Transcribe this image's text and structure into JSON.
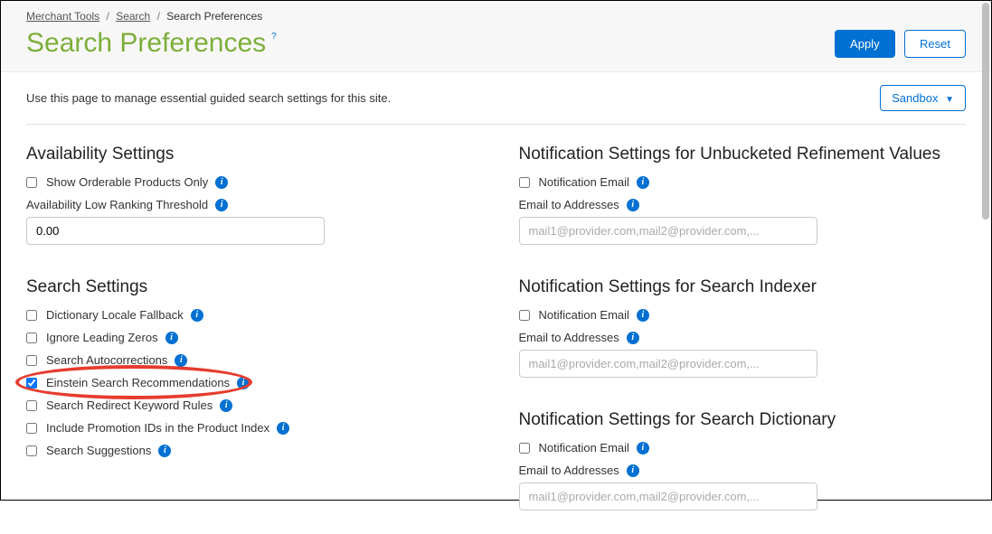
{
  "breadcrumb": {
    "item1": "Merchant Tools",
    "item2": "Search",
    "current": "Search Preferences"
  },
  "title": "Search Preferences",
  "buttons": {
    "apply": "Apply",
    "reset": "Reset"
  },
  "description": "Use this page to manage essential guided search settings for this site.",
  "env_label": "Sandbox",
  "left": {
    "availability": {
      "heading": "Availability Settings",
      "show_orderable": "Show Orderable Products Only",
      "low_ranking_label": "Availability Low Ranking Threshold",
      "low_ranking_value": "0.00"
    },
    "search": {
      "heading": "Search Settings",
      "dict_locale": "Dictionary Locale Fallback",
      "ignore_zeros": "Ignore Leading Zeros",
      "autocorrect": "Search Autocorrections",
      "einstein": "Einstein Search Recommendations",
      "redirect": "Search Redirect Keyword Rules",
      "promo_ids": "Include Promotion IDs in the Product Index",
      "suggestions": "Search Suggestions"
    }
  },
  "right": {
    "unbucketed": {
      "heading": "Notification Settings for Unbucketed Refinement Values",
      "notif_email": "Notification Email",
      "email_to": "Email to Addresses",
      "placeholder": "mail1@provider.com,mail2@provider.com,..."
    },
    "indexer": {
      "heading": "Notification Settings for Search Indexer",
      "notif_email": "Notification Email",
      "email_to": "Email to Addresses",
      "placeholder": "mail1@provider.com,mail2@provider.com,..."
    },
    "dictionary": {
      "heading": "Notification Settings for Search Dictionary",
      "notif_email": "Notification Email",
      "email_to": "Email to Addresses",
      "placeholder": "mail1@provider.com,mail2@provider.com,..."
    }
  }
}
